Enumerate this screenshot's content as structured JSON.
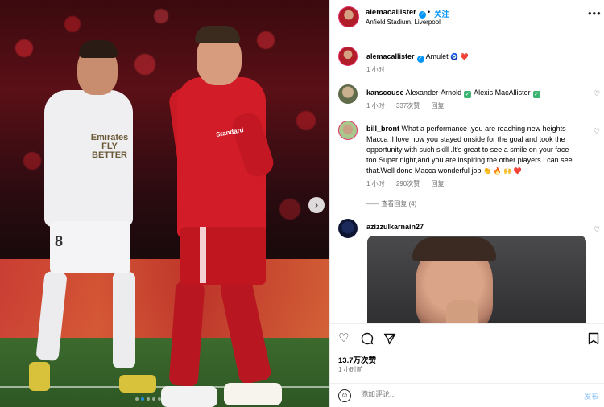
{
  "photo": {
    "next_icon": "chevron-right-icon",
    "jersey_text": "Emirates FLY BETTER",
    "shorts_number": "8",
    "red_brand": "Standard",
    "carousel_dots": 5,
    "active_dot_index": 1
  },
  "header": {
    "username": "alemacallister",
    "verified_icon": "verified-badge-icon",
    "dot": "•",
    "follow_label": "关注",
    "location": "Anfield Stadium, Liverpool",
    "more_icon": "more-horizontal-icon"
  },
  "caption": {
    "username": "alemacallister",
    "text": "Amulet",
    "emojis": "🧿 ❤️",
    "time": "1 小时"
  },
  "comments": [
    {
      "username": "kanscouse",
      "text_a": "Alexander-Arnold",
      "text_b": "Alexis MacAllister",
      "time": "1 小时",
      "likes": "337次赞",
      "reply": "回复"
    },
    {
      "username": "bill_bront",
      "text": "What a performance ,you are reaching new heights Macca .I love how you stayed onside for the goal and took the opportunity with such skill .It's great to see a smile on your face too.Super night,and you are inspiring the other players I can see that.Well done Macca wonderful job",
      "emojis": "👏 🔥 🙌 ❤️",
      "time": "1 小时",
      "likes": "290次赞",
      "reply": "回复",
      "view_replies": "—— 查看回复 (4)"
    },
    {
      "username": "azizzulkarnain27"
    }
  ],
  "actions": {
    "like_icon": "heart-icon",
    "comment_icon": "comment-icon",
    "share_icon": "send-icon",
    "save_icon": "bookmark-icon"
  },
  "likes_count": "13.7万次赞",
  "post_time": "1 小时前",
  "composer": {
    "emoji_icon": "smiley-icon",
    "placeholder": "添加评论...",
    "post_label": "发布"
  },
  "colors": {
    "accent_blue": "#0095f6",
    "verified_green": "#3cb371"
  }
}
